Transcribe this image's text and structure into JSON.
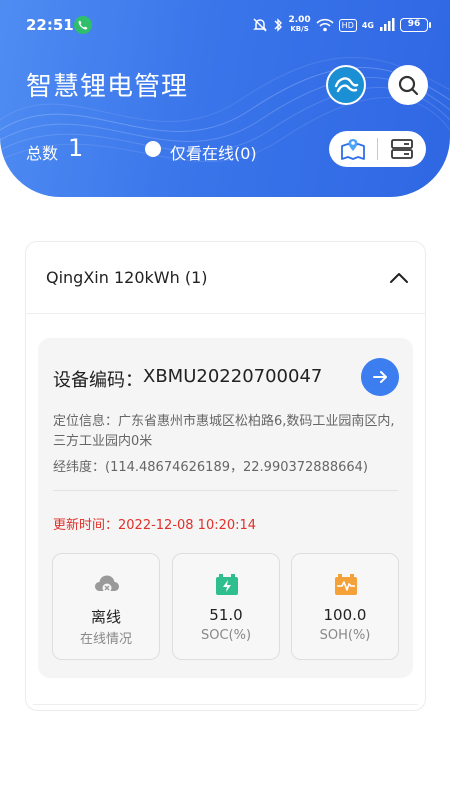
{
  "status_bar": {
    "time": "22:51",
    "network_speed_value": "2.00",
    "network_speed_unit": "KB/S",
    "hd_label": "HD",
    "signal_label": "4G",
    "battery_level": "96"
  },
  "header": {
    "title": "智慧锂电管理",
    "total_label": "总数",
    "total_value": "1",
    "online_only_label": "仅看在线(0)"
  },
  "group": {
    "title": "QingXin 120kWh (1)"
  },
  "device": {
    "code_label": "设备编码：",
    "code_value": "XBMU20220700047",
    "location": "定位信息：广东省惠州市惠城区松柏路6,数码工业园南区内,三方工业园内0米",
    "coordinates": "经纬度：(114.48674626189，22.990372888664)",
    "update_time": "更新时间：2022-12-08 10:20:14",
    "stats": [
      {
        "value": "离线",
        "label": "在线情况",
        "icon": "cloud-offline-icon"
      },
      {
        "value": "51.0",
        "label": "SOC(%)",
        "icon": "battery-charge-icon"
      },
      {
        "value": "100.0",
        "label": "SOH(%)",
        "icon": "battery-health-icon"
      }
    ]
  },
  "colors": {
    "header_blue": "#3a75ea",
    "accent_blue": "#3c7df0",
    "update_red": "#e0312a",
    "soc_green": "#2fbf8f",
    "soh_orange": "#f5a13a"
  }
}
